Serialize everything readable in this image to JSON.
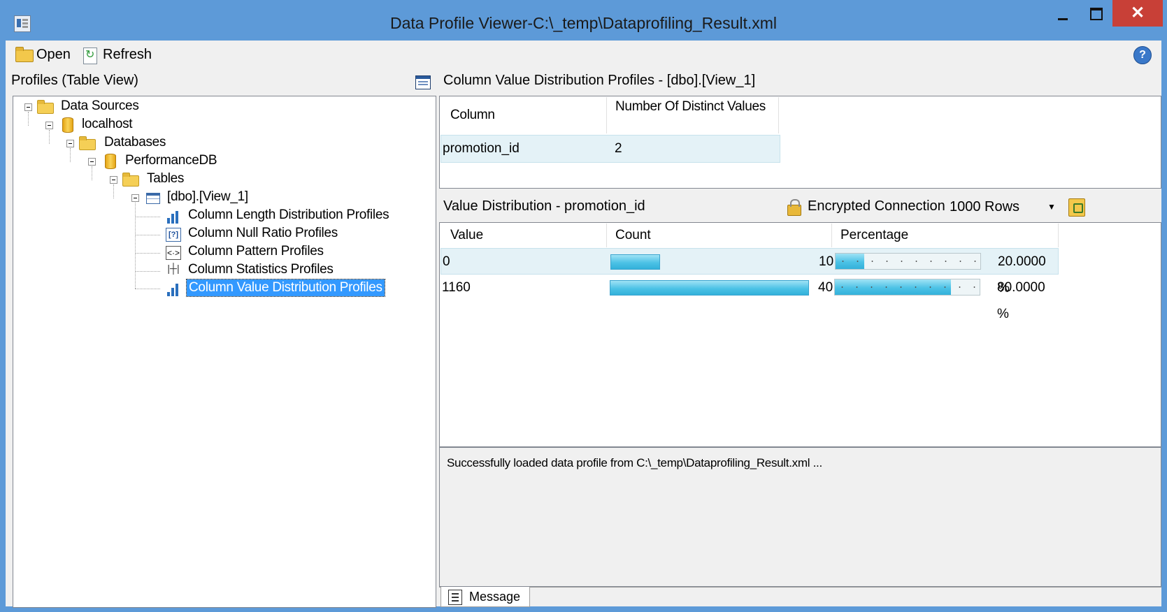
{
  "window": {
    "title": "Data Profile Viewer-C:\\_temp\\Dataprofiling_Result.xml",
    "close_glyph": "✕"
  },
  "toolbar": {
    "open_label": "Open",
    "refresh_label": "Refresh",
    "help_glyph": "?"
  },
  "left_panel": {
    "title": "Profiles (Table View)"
  },
  "tree": {
    "data_sources": "Data Sources",
    "server": "localhost",
    "databases": "Databases",
    "database": "PerformanceDB",
    "tables": "Tables",
    "table": "[dbo].[View_1]",
    "profiles": [
      "Column Length Distribution Profiles",
      "Column Null Ratio Profiles",
      "Column Pattern Profiles",
      "Column Statistics Profiles",
      "Column Value Distribution Profiles"
    ],
    "selected_profile": "Column Value Distribution Profiles"
  },
  "profile_panel": {
    "title": "Column Value Distribution Profiles  -  [dbo].[View_1]",
    "columns": [
      "Column",
      "Number Of Distinct Values"
    ],
    "rows": [
      {
        "column": "promotion_id",
        "distinct": "2"
      }
    ]
  },
  "value_distribution": {
    "title": "Value Distribution - promotion_id",
    "encrypted_label": "Encrypted Connection",
    "rows_limit": "1000 Rows",
    "columns": [
      "Value",
      "Count",
      "Percentage"
    ],
    "rows": [
      {
        "value": "0",
        "count": "10",
        "count_fraction": 0.25,
        "percentage": "20.0000 %",
        "pct_fraction": 0.2
      },
      {
        "value": "1160",
        "count": "40",
        "count_fraction": 1.0,
        "percentage": "80.0000 %",
        "pct_fraction": 0.8
      }
    ]
  },
  "messages": {
    "text": "Successfully loaded data profile from C:\\_temp\\Dataprofiling_Result.xml ...",
    "tab_label": "Message"
  },
  "colors": {
    "titlebar": "#5d9ad8",
    "close_button": "#c84037",
    "bar_fill": "#4cc2e6",
    "selected_row": "#e4f2f7",
    "tree_selection": "#3399ff"
  }
}
